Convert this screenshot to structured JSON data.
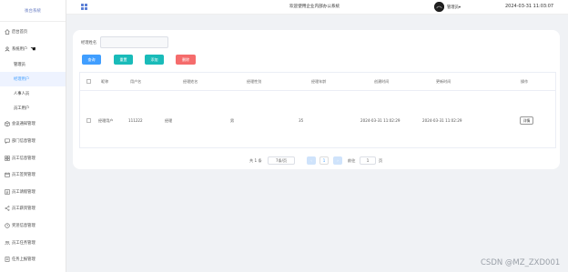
{
  "sidebar": {
    "logo": "後台系統",
    "items": [
      {
        "label": "后台首页",
        "icon": "home-icon"
      },
      {
        "label": "系统用户",
        "icon": "user-icon"
      },
      {
        "label": "会议通知管理",
        "icon": "box-icon"
      },
      {
        "label": "部门信息管理",
        "icon": "chat-icon"
      },
      {
        "label": "员工信息管理",
        "icon": "grid-icon"
      },
      {
        "label": "员工签到管理",
        "icon": "calendar-icon"
      },
      {
        "label": "员工请假管理",
        "icon": "list-icon"
      },
      {
        "label": "员工薪资管理",
        "icon": "share-icon"
      },
      {
        "label": "奖惩信息管理",
        "icon": "help-icon"
      },
      {
        "label": "员工任务管理",
        "icon": "team-icon"
      },
      {
        "label": "任务上报管理",
        "icon": "doc-icon"
      }
    ],
    "submenu": [
      "管理员",
      "经理用户",
      "人事人员",
      "员工用户"
    ]
  },
  "header": {
    "title": "欢迎使用企业内部办公系统",
    "user": "管理员",
    "user_caret": "▾",
    "time": "2024-03-31 11:03:07"
  },
  "search": {
    "label": "经理姓名",
    "placeholder": ""
  },
  "buttons": {
    "search": "查询",
    "reset": "重置",
    "add": "添加",
    "delete": "删除"
  },
  "colors": {
    "primary": "#409eff",
    "teal": "#19bbb9",
    "danger": "#f56c6c"
  },
  "table": {
    "headers": [
      "",
      "昵称",
      "用户名",
      "经理姓名",
      "经理性别",
      "经理年龄",
      "创建时间",
      "更新时间",
      "操作"
    ],
    "rows": [
      {
        "nickname": "经理用户",
        "username": "111222",
        "name": "经理",
        "gender": "男",
        "age": "35",
        "created": "2024-03-31 11:02:29",
        "updated": "2024-03-31 11:02:29",
        "action": "详情"
      }
    ]
  },
  "pagination": {
    "total": "共 1 条",
    "page_size": "7条/页",
    "prev": "‹",
    "current": "1",
    "next": "›",
    "goto": "前往",
    "goto_value": "1",
    "page_unit": "页"
  },
  "watermark": "CSDN @MZ_ZXD001"
}
